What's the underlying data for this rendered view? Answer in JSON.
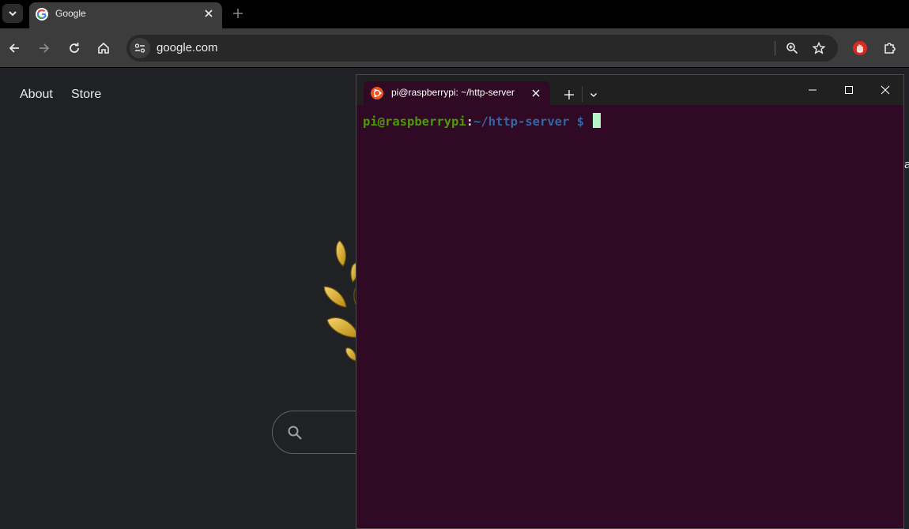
{
  "browser": {
    "tab": {
      "title": "Google"
    },
    "omnibox": {
      "url": "google.com"
    }
  },
  "page": {
    "nav": {
      "about": "About",
      "store": "Store"
    },
    "edge_text": "ag"
  },
  "terminal": {
    "tab_title": "pi@raspberrypi: ~/http-server",
    "prompt": {
      "user_host": "pi@raspberrypi",
      "colon": ":",
      "path": "~/http-server",
      "symbol": " $ "
    }
  },
  "colors": {
    "browser_bg": "#202124",
    "toolbar": "#3c3c3c",
    "terminal_bg": "#300a24",
    "prompt_green": "#4e9a06",
    "prompt_blue": "#3465a4",
    "cursor": "#b5f5c8",
    "ubuntu_red": "#e95420"
  },
  "icons": [
    "tab-search-icon",
    "google-g-icon",
    "close-icon",
    "plus-icon",
    "back-arrow-icon",
    "forward-arrow-icon",
    "reload-icon",
    "home-icon",
    "site-info-icon",
    "zoom-icon",
    "star-icon",
    "extension-hand-icon",
    "puzzle-icon",
    "search-icon",
    "ubuntu-icon",
    "chevron-down-icon",
    "minimize-icon",
    "maximize-icon"
  ]
}
